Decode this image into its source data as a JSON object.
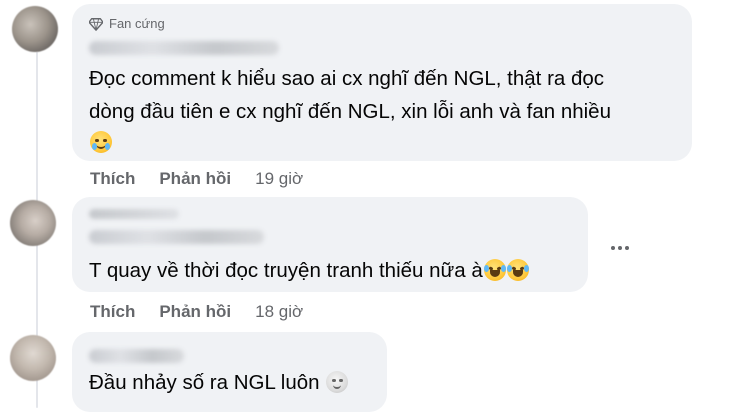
{
  "comments": [
    {
      "badge": "Fan cứng",
      "text_lines": [
        "Đọc comment k hiểu sao ai cx nghĩ đến NGL, thật ra đọc",
        "dòng đầu tiên e cx nghĩ đến NGL, xin lỗi anh và fan nhiều"
      ],
      "emoji": "face-holding-back-tears",
      "like_label": "Thích",
      "reply_label": "Phản hồi",
      "time": "19 giờ"
    },
    {
      "text": "T quay về thời đọc truyện tranh thiếu nữa à",
      "emoji": "rolling-on-floor-laughing",
      "like_label": "Thích",
      "reply_label": "Phản hồi",
      "time": "18 giờ",
      "more_icon": "more-options-icon"
    },
    {
      "text": "Đầu nhảy số ra NGL luôn",
      "emoji": "moon-face"
    }
  ]
}
